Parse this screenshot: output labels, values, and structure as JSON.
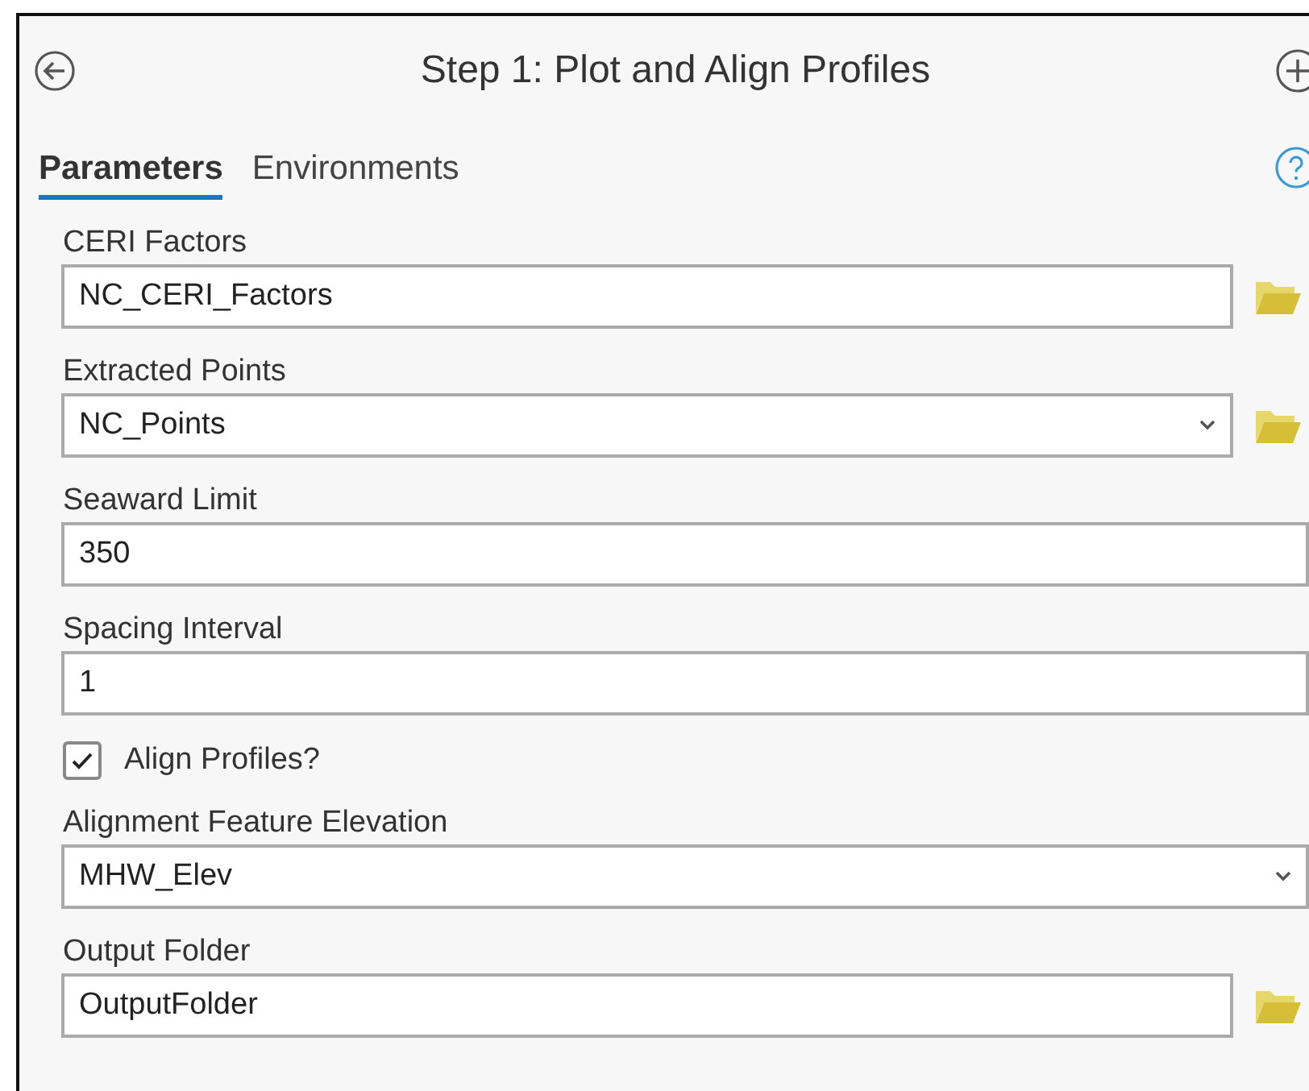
{
  "header": {
    "title": "Step 1: Plot and Align Profiles"
  },
  "tabs": [
    {
      "label": "Parameters",
      "selected": true
    },
    {
      "label": "Environments",
      "selected": false
    }
  ],
  "parameters": [
    {
      "kind": "text",
      "label": "CERI Factors",
      "value": "NC_CERI_Factors",
      "browse": true
    },
    {
      "kind": "dropdown",
      "label": "Extracted Points",
      "value": "NC_Points",
      "browse": true
    },
    {
      "kind": "text",
      "label": "Seaward Limit",
      "value": "350",
      "browse": false
    },
    {
      "kind": "text",
      "label": "Spacing Interval",
      "value": "1",
      "browse": false
    },
    {
      "kind": "checkbox",
      "label": "Align Profiles?",
      "checked": true
    },
    {
      "kind": "dropdown",
      "label": "Alignment Feature Elevation",
      "value": "MHW_Elev",
      "browse": false
    },
    {
      "kind": "text",
      "label": "Output Folder",
      "value": "OutputFolder",
      "browse": true
    }
  ]
}
